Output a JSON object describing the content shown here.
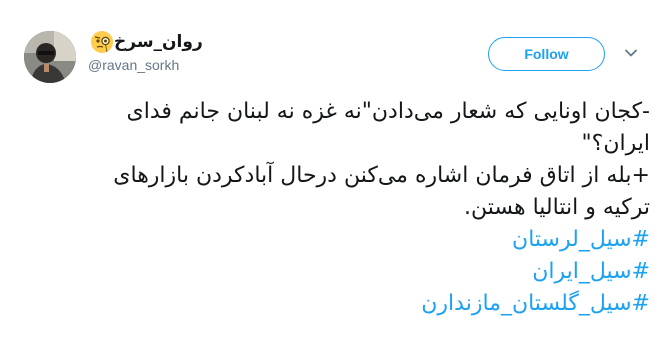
{
  "user": {
    "display_name": "روان_سرخ",
    "handle": "@ravan_sorkh",
    "emoji": "monocle-face-icon"
  },
  "actions": {
    "follow_label": "Follow"
  },
  "tweet": {
    "lines": [
      "-کجان اونایی که شعار می‌دادن\"نه غزه نه لبنان جانم فدای",
      "ایران؟\"",
      "+بله از اتاق فرمان اشاره می‌کنن درحال آبادکردن بازارهای",
      "ترکیه و انتالیا هستن."
    ],
    "hashtags": [
      "#سیل_لرستان",
      "#سیل_ایران",
      "#سیل_گلستان_مازندارن"
    ]
  },
  "colors": {
    "accent": "#1da1f2",
    "text": "#14171a",
    "secondary": "#657786"
  }
}
